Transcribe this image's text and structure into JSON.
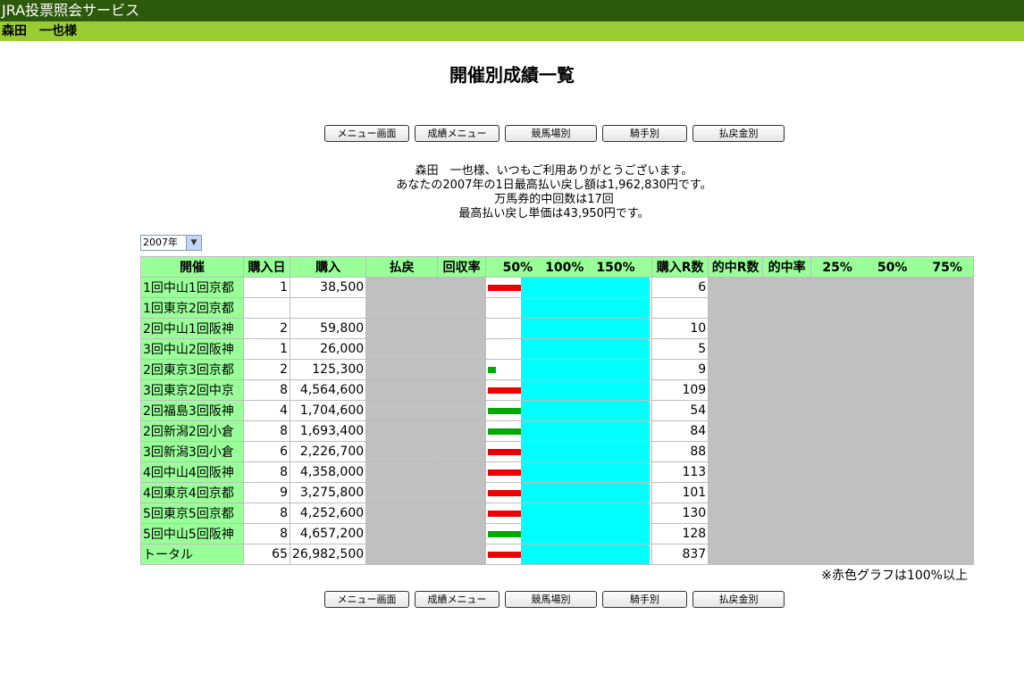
{
  "app": {
    "title": "JRA投票照会サービス",
    "user": "森田　一也様"
  },
  "page": {
    "title": "開催別成績一覧"
  },
  "buttons": [
    "メニュー画面",
    "成績メニュー",
    "競馬場別",
    "騎手別",
    "払戻金別"
  ],
  "messages": [
    "森田　一也様、いつもご利用ありがとうございます。",
    "あなたの2007年の1日最高払い戻し額は1,962,830円です。",
    "万馬券的中回数は17回",
    "最高払い戻し単価は43,950円です。"
  ],
  "year_select": {
    "value": "2007年"
  },
  "table": {
    "headers": [
      "開催",
      "購入日",
      "購入",
      "払戻",
      "回収率",
      "50%　100%　150%",
      "購入R数",
      "的中R数",
      "的中率",
      "25%　　50%　　75%"
    ],
    "rows": [
      {
        "kaisai": "1回中山1回京都",
        "days": "1",
        "purchase": "38,500",
        "races": "6",
        "bar": {
          "ratio": 0.23,
          "color": "#ee0000"
        }
      },
      {
        "kaisai": "1回東京2回京都",
        "days": "",
        "purchase": "",
        "races": "",
        "bar": null
      },
      {
        "kaisai": "2回中山1回阪神",
        "days": "2",
        "purchase": "59,800",
        "races": "10",
        "bar": null
      },
      {
        "kaisai": "3回中山2回阪神",
        "days": "1",
        "purchase": "26,000",
        "races": "5",
        "bar": null
      },
      {
        "kaisai": "2回東京3回京都",
        "days": "2",
        "purchase": "125,300",
        "races": "9",
        "bar": {
          "ratio": 0.055,
          "color": "#00aa00"
        }
      },
      {
        "kaisai": "3回東京2回中京",
        "days": "8",
        "purchase": "4,564,600",
        "races": "109",
        "bar": {
          "ratio": 0.23,
          "color": "#ee0000"
        }
      },
      {
        "kaisai": "2回福島3回阪神",
        "days": "4",
        "purchase": "1,704,600",
        "races": "54",
        "bar": {
          "ratio": 0.23,
          "color": "#00aa00"
        }
      },
      {
        "kaisai": "2回新潟2回小倉",
        "days": "8",
        "purchase": "1,693,400",
        "races": "84",
        "bar": {
          "ratio": 0.23,
          "color": "#00aa00"
        }
      },
      {
        "kaisai": "3回新潟3回小倉",
        "days": "6",
        "purchase": "2,226,700",
        "races": "88",
        "bar": {
          "ratio": 0.23,
          "color": "#ee0000"
        }
      },
      {
        "kaisai": "4回中山4回阪神",
        "days": "8",
        "purchase": "4,358,000",
        "races": "113",
        "bar": {
          "ratio": 0.23,
          "color": "#ee0000"
        }
      },
      {
        "kaisai": "4回東京4回京都",
        "days": "9",
        "purchase": "3,275,800",
        "races": "101",
        "bar": {
          "ratio": 0.23,
          "color": "#ee0000"
        }
      },
      {
        "kaisai": "5回東京5回京都",
        "days": "8",
        "purchase": "4,252,600",
        "races": "130",
        "bar": {
          "ratio": 0.23,
          "color": "#ee0000"
        }
      },
      {
        "kaisai": "5回中山5回阪神",
        "days": "8",
        "purchase": "4,657,200",
        "races": "128",
        "bar": {
          "ratio": 0.23,
          "color": "#00aa00"
        }
      },
      {
        "kaisai": "トータル",
        "days": "65",
        "purchase": "26,982,500",
        "races": "837",
        "bar": {
          "ratio": 0.23,
          "color": "#ee0000"
        }
      }
    ]
  },
  "note": "※赤色グラフは100%以上"
}
